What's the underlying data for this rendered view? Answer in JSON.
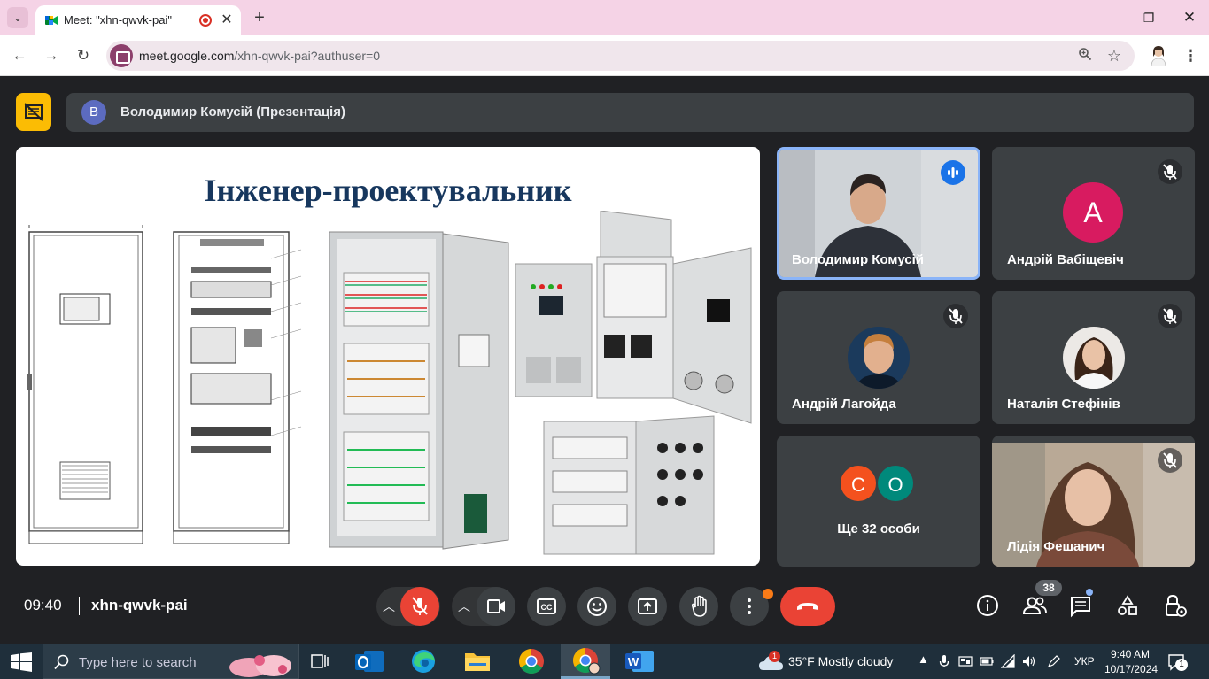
{
  "browser": {
    "tab_title": "Meet: \"xhn-qwvk-pai\"",
    "url_host": "meet.google.com",
    "url_path": "/xhn-qwvk-pai?authuser=0",
    "accent": "#f5d3e6"
  },
  "meet": {
    "presenter_initial": "В",
    "presenter_label": "Володимир Комусій (Презентація)",
    "slide_title": "Інженер-проектувальник",
    "participants": [
      {
        "name": "Володимир Комусій"
      },
      {
        "name": "Андрій Вабіщевіч",
        "initial": "А",
        "color": "#d81b60"
      },
      {
        "name": "Андрій Лагойда"
      },
      {
        "name": "Наталія Стефінів"
      },
      {
        "others_label": "Ще 32 особи",
        "initials": [
          "С",
          "О"
        ],
        "colors": [
          "#f4511e",
          "#00897b"
        ]
      },
      {
        "name": "Лідія Фешанич"
      }
    ],
    "clock": "09:40",
    "meeting_code": "xhn-qwvk-pai",
    "people_count": "38",
    "colors": {
      "hangup": "#ea4335",
      "speaking": "#1a73e8",
      "present": "#fbbc04"
    }
  },
  "taskbar": {
    "search_placeholder": "Type here to search",
    "weather_badge": "1",
    "weather": "35°F  Mostly cloudy",
    "language": "УКР",
    "time": "9:40 AM",
    "date": "10/17/2024",
    "notif_count": "1"
  }
}
